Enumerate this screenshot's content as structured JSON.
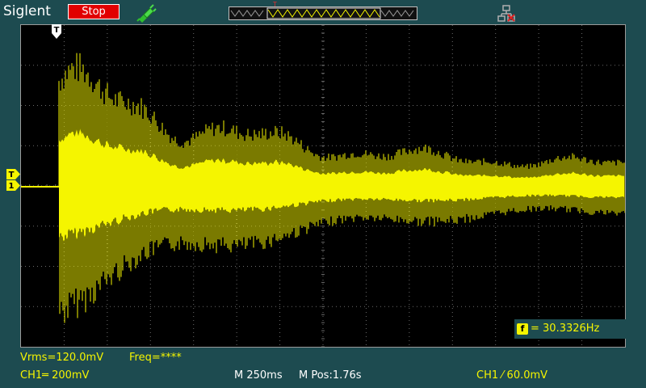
{
  "header": {
    "brand": "Siglent",
    "run_state_label": "Stop",
    "trigger_icon": "probe-icon",
    "network_icon": "network-icon"
  },
  "time_overview": {
    "marker": "T"
  },
  "markers": {
    "trigger_position": "T",
    "trigger_level": "T",
    "channel_1": "1"
  },
  "frequency_readout": {
    "badge": "f",
    "text": "= 30.3326Hz"
  },
  "measurements": {
    "vrms": "Vrms=120.0mV",
    "freq": "Freq=****"
  },
  "status": {
    "ch1_scale": "CH1═ 200mV",
    "timebase": "M 250ms",
    "mpos": "M Pos:1.76s",
    "trigger": "CH1 ⁄ 60.0mV"
  },
  "colors": {
    "background": "#1d4b50",
    "trace": "#f5f500",
    "stop": "#e10000",
    "grid": "#6b6b6b"
  }
}
